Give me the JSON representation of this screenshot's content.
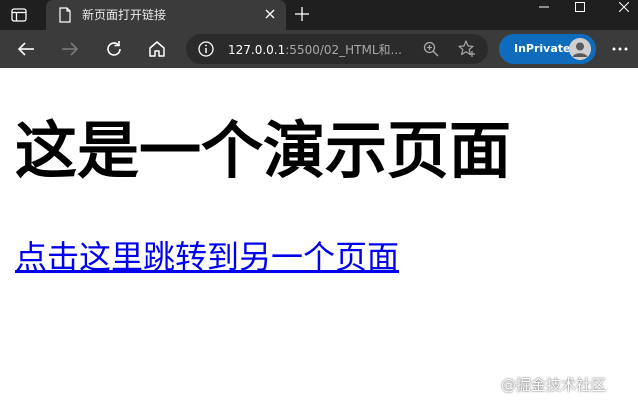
{
  "tab": {
    "title": "新页面打开链接"
  },
  "address_bar": {
    "url_host": "127.0.0.1",
    "url_rest": ":5500/02_HTML和..."
  },
  "inprivate": {
    "label": "InPrivate"
  },
  "page": {
    "heading": "这是一个演示页面",
    "link_text": "点击这里跳转到另一个页面"
  },
  "watermark": {
    "text": "@掘金技术社区"
  },
  "icons": {
    "tab_actions": "tab-actions-icon",
    "favicon": "document-icon",
    "tab_close": "close-icon",
    "new_tab": "plus-icon",
    "back": "back-arrow-icon",
    "forward": "forward-arrow-icon",
    "refresh": "refresh-icon",
    "home": "home-icon",
    "info": "info-icon",
    "zoom": "zoom-icon",
    "favorites": "favorites-star-icon",
    "more": "more-icon"
  },
  "colors": {
    "tabstrip_bg": "#1f1f1f",
    "toolbar_bg": "#3b3b3b",
    "inprivate_bg": "#0f6cbd",
    "link": "#0000ee"
  }
}
